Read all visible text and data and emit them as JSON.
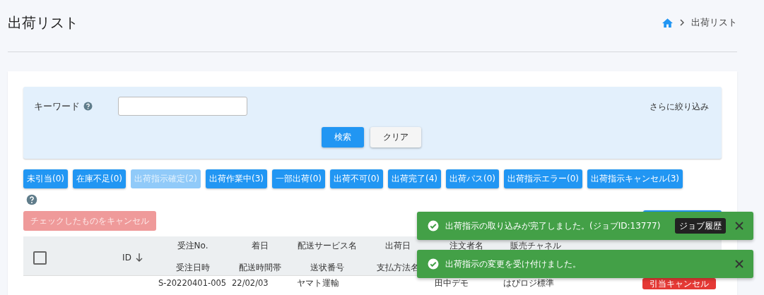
{
  "page": {
    "title": "出荷リスト"
  },
  "breadcrumb": [
    "出荷リスト"
  ],
  "filter": {
    "keyword_label": "キーワード",
    "more_filters": "さらに絞り込み",
    "search_button": "検索",
    "clear_button": "クリア"
  },
  "status_buttons": [
    {
      "label": "未引当(0)",
      "disabled": false
    },
    {
      "label": "在庫不足(0)",
      "disabled": false
    },
    {
      "label": "出荷指示確定(2)",
      "disabled": true
    },
    {
      "label": "出荷作業中(3)",
      "disabled": false
    },
    {
      "label": "一部出荷(0)",
      "disabled": false
    },
    {
      "label": "出荷不可(0)",
      "disabled": false
    },
    {
      "label": "出荷完了(4)",
      "disabled": false
    },
    {
      "label": "出荷パス(0)",
      "disabled": false
    },
    {
      "label": "出荷指示エラー(0)",
      "disabled": false
    },
    {
      "label": "出荷指示キャンセル(3)",
      "disabled": false
    }
  ],
  "cancel_checked": {
    "label": "チェックしたものをキャンセル",
    "disabled": true
  },
  "table": {
    "select_all": {
      "checked": false
    },
    "columns": [
      {
        "top": "ID",
        "sortable": true
      },
      {
        "top": "受注No.",
        "bottom": "受注日時"
      },
      {
        "top": "着日",
        "bottom": "配送時間帯"
      },
      {
        "top": "配送サービス名",
        "bottom": "送状番号"
      },
      {
        "top": "出荷日",
        "bottom": "支払方法名"
      },
      {
        "top": "注文者名"
      },
      {
        "top": "販売チャネル"
      }
    ],
    "rows": [
      {
        "order_no": "S-20220401-005",
        "arrival_date": "22/02/03",
        "delivery_service": "ヤマト運輸",
        "orderer": "田中デモ",
        "sales_channel": "はぴロジ標準",
        "action": "引当キャンセル"
      }
    ]
  },
  "toasts": [
    {
      "message": "出荷指示の取り込みが完了しました。(ジョブID:13777)",
      "action": "ジョブ履歴"
    },
    {
      "message": "出荷指示の変更を受け付けました。"
    }
  ]
}
